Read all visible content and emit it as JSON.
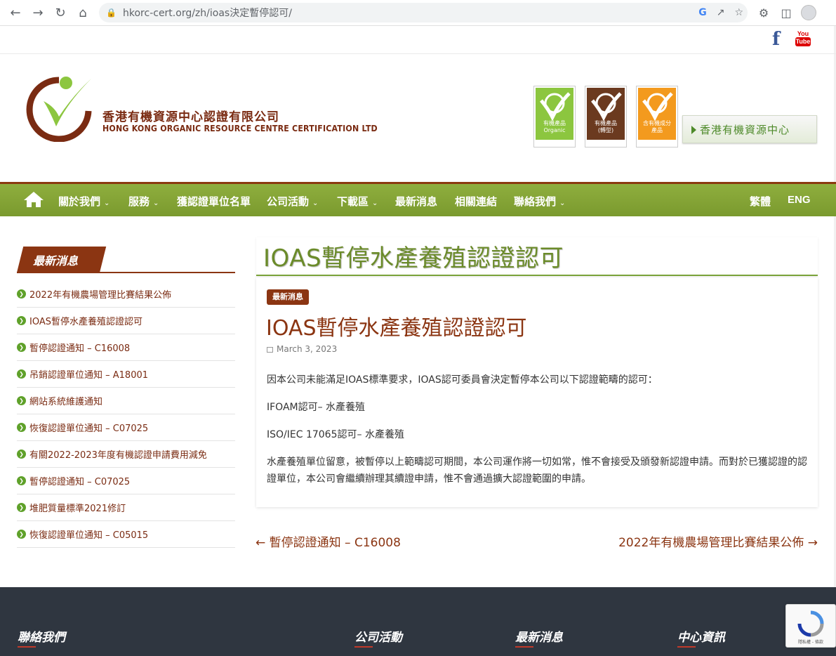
{
  "browser": {
    "url_host": "hkorc-cert.org",
    "url_path": "/zh/ioas決定暫停認可/"
  },
  "social": {
    "facebook": "f",
    "youtube_top": "You",
    "youtube_bottom": "Tube"
  },
  "header": {
    "company_cn": "香港有機資源中心認證有限公司",
    "company_en": "HONG KONG ORGANIC RESOURCE CENTRE CERTIFICATION LTD",
    "badges": [
      {
        "label": "有機產品\nOrganic",
        "color": "#8cc63f"
      },
      {
        "label": "有機產品\n(轉型)",
        "color": "#6b3a1f"
      },
      {
        "label": "含有機成分\n產品",
        "color": "#f39a1e"
      }
    ],
    "hk_button": "香港有機資源中心"
  },
  "nav": {
    "items": [
      {
        "label": "關於我們",
        "caret": true
      },
      {
        "label": "服務",
        "caret": true
      },
      {
        "label": "獲認證單位名單",
        "caret": false
      },
      {
        "label": "公司活動",
        "caret": true
      },
      {
        "label": "下載區",
        "caret": true
      },
      {
        "label": "最新消息",
        "caret": false
      },
      {
        "label": "相關連結",
        "caret": false
      },
      {
        "label": "聯絡我們",
        "caret": true
      }
    ],
    "lang_zh": "繁體",
    "lang_en": "ENG"
  },
  "sidebar": {
    "title": "最新消息",
    "items": [
      "2022年有機農場管理比賽結果公佈",
      "IOAS暫停水產養殖認證認可",
      "暫停認證通知 – C16008",
      "吊銷認證單位通知 – A18001",
      "網站系統維護通知",
      "恢復認證單位通知 – C07025",
      "有關2022-2023年度有機認證申請費用減免",
      "暫停認證通知 – C07025",
      "堆肥質量標準2021修訂",
      "恢復認證單位通知 – C05015"
    ]
  },
  "main": {
    "page_title": "IOAS暫停水產養殖認證認可",
    "category": "最新消息",
    "post_title": "IOAS暫停水產養殖認證認可",
    "date": "March 3, 2023",
    "paragraphs": [
      "因本公司未能滿足IOAS標準要求，IOAS認可委員會決定暫停本公司以下認證範疇的認可：",
      "IFOAM認可– 水產養殖",
      "ISO/IEC 17065認可– 水產養殖",
      "水產養殖單位留意，被暫停以上範疇認可期間，本公司運作將一切如常，惟不會接受及頒發新認證申請。而對於已獲認證的認證單位，本公司會繼續辦理其續證申請，惟不會通過擴大認證範圍的申請。"
    ],
    "prev_link": "← 暫停認證通知 – C16008",
    "next_link": "2022年有機農場管理比賽結果公佈 →"
  },
  "footer": {
    "headings": [
      "聯絡我們",
      "公司活動",
      "最新消息",
      "中心資訊"
    ],
    "recaptcha_text": "隱私權 - 條款"
  }
}
